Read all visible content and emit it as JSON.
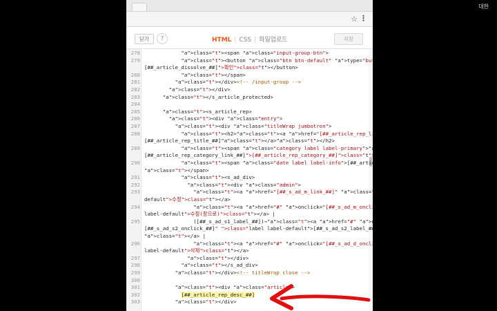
{
  "browser": {
    "right_tab_text": "대한",
    "star_icon": "star-icon",
    "menu_icon": "kebab-menu-icon"
  },
  "toolbar": {
    "close_label": "닫기",
    "help_label": "?",
    "tab_html": "HTML",
    "tab_css": "CSS",
    "tab_upload": "파일업로드",
    "save_label": "저장",
    "sep": "|"
  },
  "code_lines": [
    {
      "num": "278",
      "text": "            <span class=\"input-group-btn\">"
    },
    {
      "num": "279",
      "text": "            <button class=\"btn btn-default\" type=\"button\" onclick=\""
    },
    {
      "num": "",
      "text": "[##_article_dissolve_##]\">확인</button>"
    },
    {
      "num": "280",
      "text": "            </span>"
    },
    {
      "num": "281",
      "text": "          </div><!-- /input-group -->"
    },
    {
      "num": "282",
      "text": "        </div>"
    },
    {
      "num": "283",
      "text": "      </s_article_protected>"
    },
    {
      "num": "284",
      "text": ""
    },
    {
      "num": "285",
      "text": "      <s_article_rep>"
    },
    {
      "num": "286",
      "text": "        <div class=\"entry\">"
    },
    {
      "num": "287",
      "text": "          <div class=\"titleWrap jumbotron\">"
    },
    {
      "num": "288",
      "text": "            <h2><a href=\"[##_article_rep_link_##]\">"
    },
    {
      "num": "",
      "text": "[##_article_rep_title_##]</a></h2>"
    },
    {
      "num": "289",
      "text": "            <span class=\"category label label-primary\"><a href=\""
    },
    {
      "num": "",
      "text": "[##_article_rep_category_link_##]\">[##_article_rep_category_##]</a></span>"
    },
    {
      "num": "290",
      "text": "            <span class=\"date label label-info\">[##_article_rep_date_##]"
    },
    {
      "num": "",
      "text": "</span>"
    },
    {
      "num": "291",
      "text": "            <s_ad_div>"
    },
    {
      "num": "292",
      "text": "              <div class=\"admin\">"
    },
    {
      "num": "293",
      "text": "                <a href=\"[##_s_ad_m_link_##]\" class=\"label label-"
    },
    {
      "num": "",
      "text": "default\">수정</a>"
    },
    {
      "num": "294",
      "text": "                <a href=\"#\" onclick=\"[##_s_ad_m_onclick_##]\" class=\"label"
    },
    {
      "num": "",
      "text": "label-default\">수정(창으로)</a> |"
    },
    {
      "num": "295",
      "text": "                ([##_s_ad_s1_label_##])→<a href=\"#\" onclick=\""
    },
    {
      "num": "",
      "text": "[##_s_ad_s2_onclick_##]\" class=\"label label-default\">[##_s_ad_s2_label_##]"
    },
    {
      "num": "",
      "text": "</a> |"
    },
    {
      "num": "296",
      "text": "                <a href=\"#\" onclick=\"[##_s_ad_d_onclick_##]\" class=\"label"
    },
    {
      "num": "",
      "text": "label-default\">삭제</a>"
    },
    {
      "num": "297",
      "text": "              </div>"
    },
    {
      "num": "298",
      "text": "            </s_ad_div>"
    },
    {
      "num": "299",
      "text": "          </div><!-- titleWrap close -->"
    },
    {
      "num": "300",
      "text": ""
    },
    {
      "num": "301",
      "text": "          <div class=\"article\">"
    },
    {
      "num": "302",
      "text": "            [##_article_rep_desc_##]"
    },
    {
      "num": "303",
      "text": "          </div>"
    }
  ],
  "highlight_line": "302",
  "colors": {
    "accent": "#e8541c",
    "arrow": "#e01010",
    "highlight": "#fff6a8"
  }
}
